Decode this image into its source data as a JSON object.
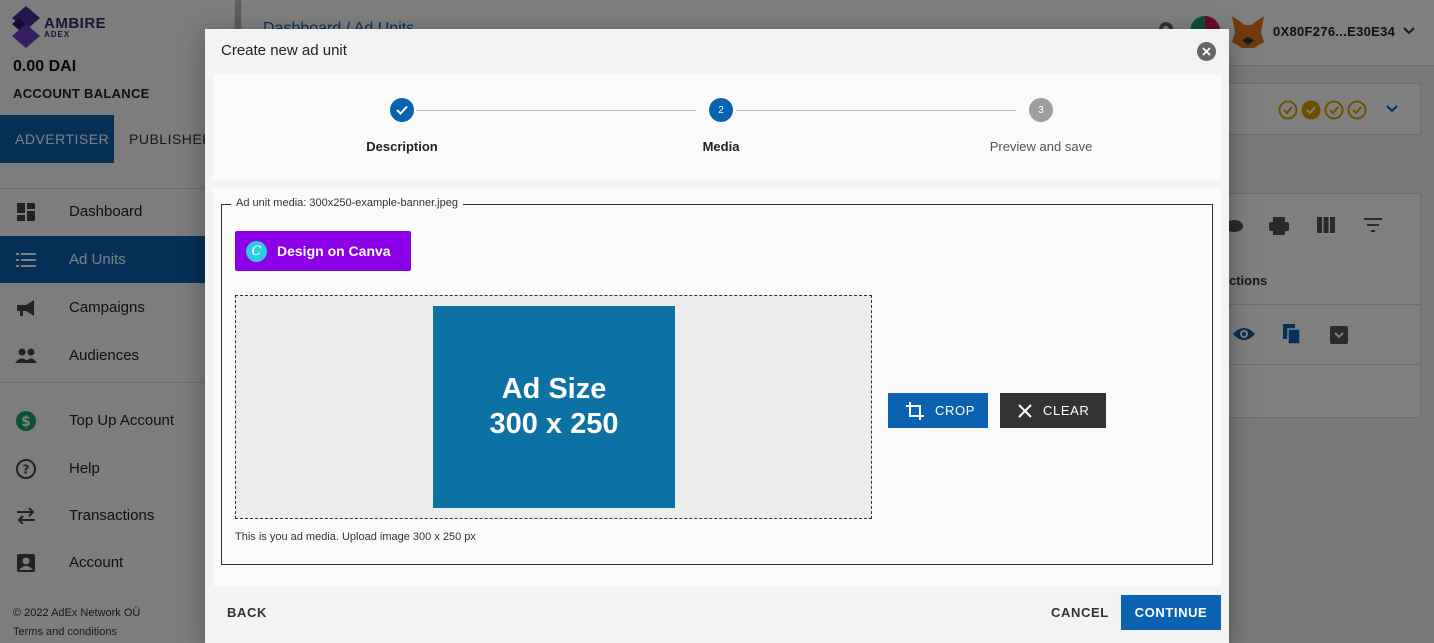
{
  "app": {
    "logo": {
      "line1": "AMBIRE",
      "line2": "ADEX"
    },
    "balance": {
      "amount": "0.00 DAI",
      "label": "ACCOUNT BALANCE"
    },
    "role_tabs": [
      "ADVERTISER",
      "PUBLISHER"
    ],
    "nav": [
      "Dashboard",
      "Ad Units",
      "Campaigns",
      "Audiences",
      "Top Up Account",
      "Help",
      "Transactions",
      "Account"
    ],
    "footer": {
      "copyright": "© 2022  AdEx Network OÜ",
      "terms": "Terms and conditions"
    },
    "breadcrumb": "Dashboard  /  Ad Units",
    "wallet": "0X80F276...E30E34",
    "table_header_fragment": "ctions"
  },
  "modal": {
    "title": "Create new ad unit",
    "steps": [
      {
        "number": "1",
        "label": "Description",
        "state": "completed"
      },
      {
        "number": "2",
        "label": "Media",
        "state": "active"
      },
      {
        "number": "3",
        "label": "Preview and save",
        "state": "pending"
      }
    ],
    "media": {
      "legend": "Ad unit media: 300x250-example-banner.jpeg",
      "canva_button": "Design on Canva",
      "preview_line1": "Ad Size",
      "preview_line2": "300 x 250",
      "helper": "This is you ad media. Upload image 300 x 250 px",
      "crop_label": "CROP",
      "clear_label": "CLEAR"
    },
    "footer": {
      "back": "BACK",
      "cancel": "CANCEL",
      "continue": "CONTINUE"
    }
  },
  "colors": {
    "primary": "#0b62b0",
    "canva": "#8b00e6",
    "preview_bg": "#0b72a3",
    "gold": "#d9a000",
    "dark_button": "#333333"
  }
}
